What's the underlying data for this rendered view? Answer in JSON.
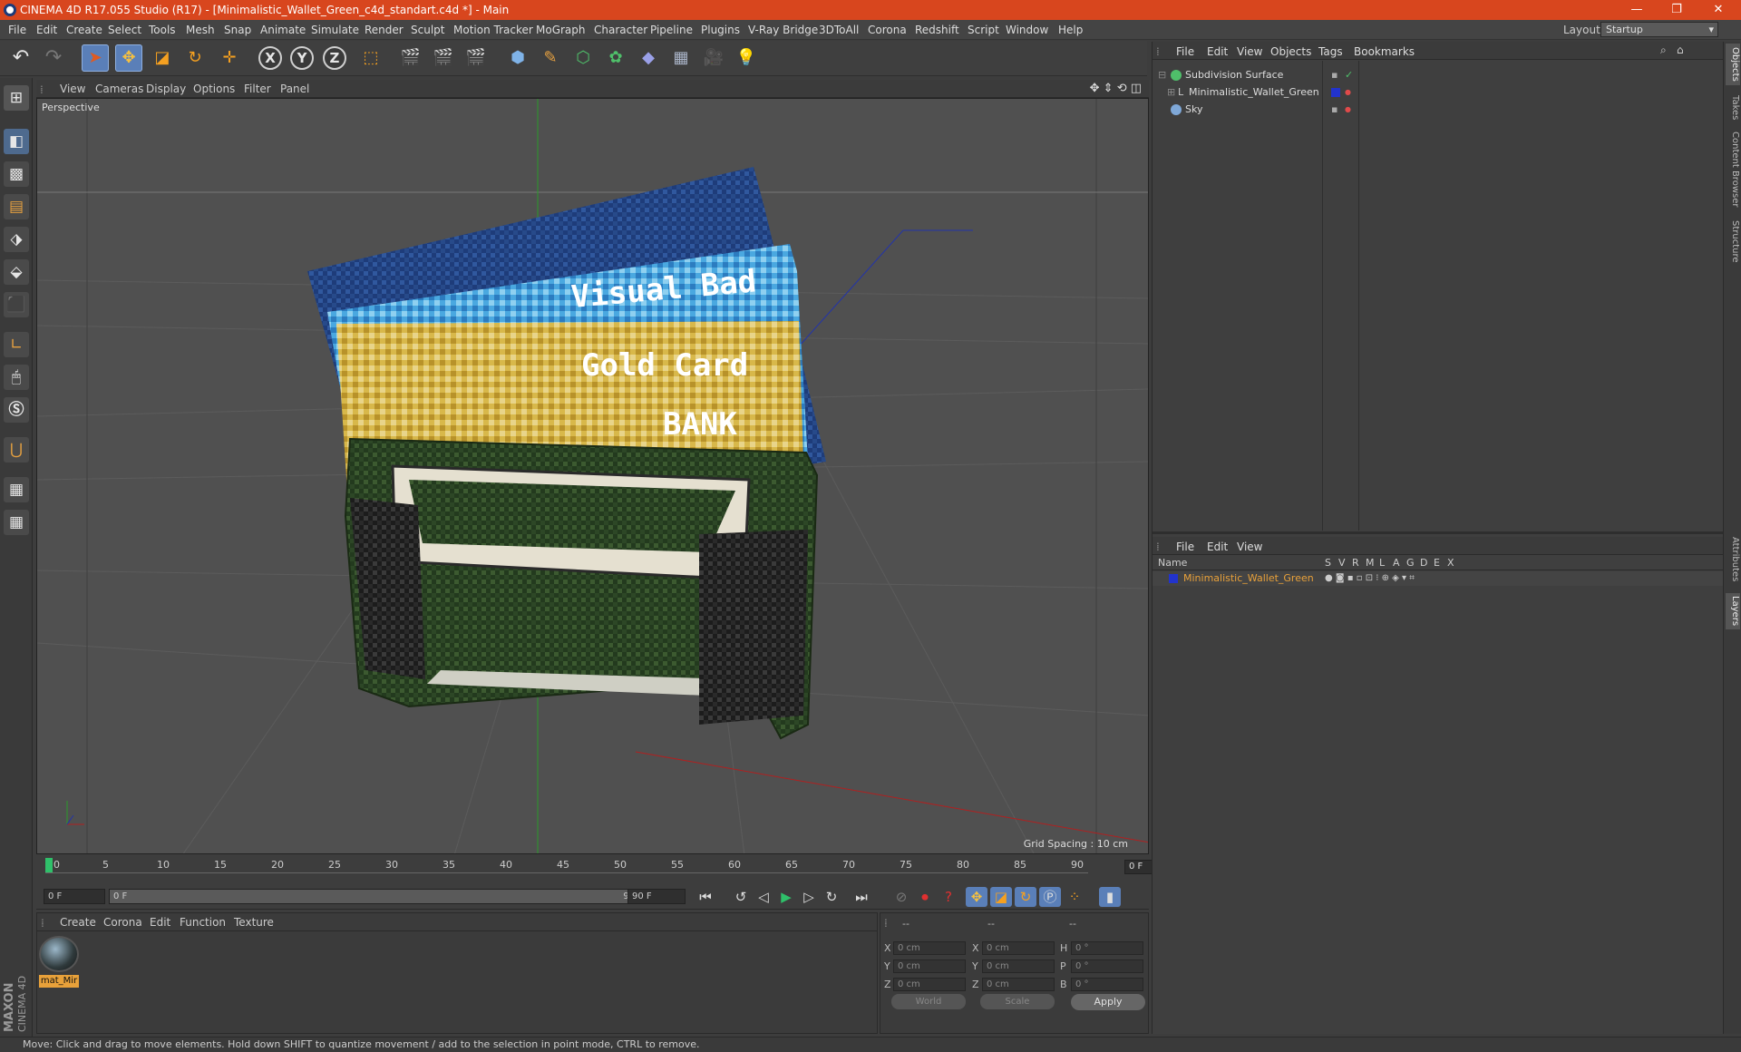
{
  "window": {
    "title": "CINEMA 4D R17.055 Studio (R17) - [Minimalistic_Wallet_Green_c4d_standart.c4d *] - Main",
    "controls": [
      "—",
      "❐",
      "✕"
    ]
  },
  "menubar": {
    "items": [
      "File",
      "Edit",
      "Create",
      "Select",
      "Tools",
      "Mesh",
      "Snap",
      "Animate",
      "Simulate",
      "Render",
      "Sculpt",
      "Motion Tracker",
      "MoGraph",
      "Character",
      "Pipeline",
      "Plugins",
      "V-Ray Bridge",
      "3DToAll",
      "Corona",
      "Redshift",
      "Script",
      "Window",
      "Help"
    ],
    "layout_label": "Layout:",
    "layout_value": "Startup"
  },
  "toolbar": {
    "undo": "↶",
    "redo": "↷",
    "axis_x": "X",
    "axis_y": "Y",
    "axis_z": "Z"
  },
  "viewport": {
    "menu": [
      "View",
      "Cameras",
      "Display",
      "Options",
      "Filter",
      "Panel"
    ],
    "label": "Perspective",
    "grid_spacing": "Grid Spacing : 10 cm",
    "card_text_1": "Visual Bad",
    "card_text_2": "Gold Card",
    "card_text_3": "BANK"
  },
  "timeline": {
    "ticks": [
      "0",
      "5",
      "10",
      "15",
      "20",
      "25",
      "30",
      "35",
      "40",
      "45",
      "50",
      "55",
      "60",
      "65",
      "70",
      "75",
      "80",
      "85",
      "90"
    ],
    "current_frame": "0 F",
    "start_frame": "0 F",
    "range_start": "0 F",
    "range_end": "90 F",
    "end_frame": "90 F"
  },
  "material_manager": {
    "menu": [
      "Create",
      "Corona",
      "Edit",
      "Function",
      "Texture"
    ],
    "material_name": "mat_Mir"
  },
  "coordinates": {
    "headers": [
      "--",
      "--",
      "--"
    ],
    "rows": [
      {
        "a": "X",
        "av": "0 cm",
        "b": "X",
        "bv": "0 cm",
        "c": "H",
        "cv": "0 °"
      },
      {
        "a": "Y",
        "av": "0 cm",
        "b": "Y",
        "bv": "0 cm",
        "c": "P",
        "cv": "0 °"
      },
      {
        "a": "Z",
        "av": "0 cm",
        "b": "Z",
        "bv": "0 cm",
        "c": "B",
        "cv": "0 °"
      }
    ],
    "mode_world": "World",
    "mode_scale": "Scale",
    "apply": "Apply"
  },
  "object_manager": {
    "menu": [
      "File",
      "Edit",
      "View",
      "Objects",
      "Tags",
      "Bookmarks"
    ],
    "objects": [
      {
        "name": "Subdivision Surface",
        "icon_color": "#4fbf6a"
      },
      {
        "name": "Minimalistic_Wallet_Green",
        "icon_color": "#c0c0c0",
        "tag_color": "#2233cc"
      },
      {
        "name": "Sky",
        "icon_color": "#7fa8d8"
      }
    ]
  },
  "layer_manager": {
    "menu": [
      "File",
      "Edit",
      "View"
    ],
    "columns": [
      "Name",
      "S",
      "V",
      "R",
      "M",
      "L",
      "A",
      "G",
      "D",
      "E",
      "X"
    ],
    "layers": [
      {
        "name": "Minimalistic_Wallet_Green",
        "color": "#2233cc"
      }
    ]
  },
  "side_tabs": [
    "Objects",
    "Takes",
    "Content Browser",
    "Structure",
    "Attributes",
    "Layers"
  ],
  "statusbar": {
    "text": "Move: Click and drag to move elements. Hold down SHIFT to quantize movement / add to the selection in point mode, CTRL to remove."
  },
  "branding": {
    "logo": "MAXON CINEMA 4D"
  },
  "colors": {
    "accent": "#d8461e",
    "selection": "#e8a13a",
    "active_tool": "#5a7fb8"
  }
}
